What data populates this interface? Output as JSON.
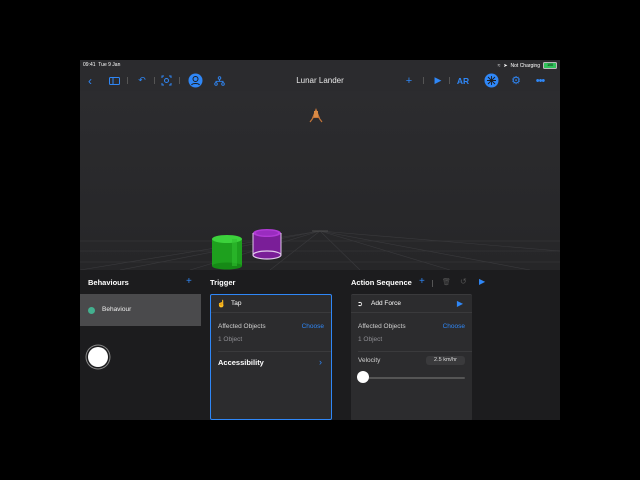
{
  "status": {
    "time": "09:41",
    "date": "Tue 9 Jan",
    "battery_text": "Not Charging",
    "battery_pct": "100"
  },
  "toolbar": {
    "title": "Lunar Lander",
    "icons": [
      "back-chevron-icon",
      "sidebar-icon",
      "undo-icon",
      "frame-icon",
      "avatar-icon",
      "hierarchy-icon",
      "add-icon",
      "play-icon",
      "ar-icon",
      "behaviours-icon",
      "settings-icon",
      "more-icon"
    ],
    "ar_label": "AR",
    "accent_color": "#2f87f7"
  },
  "behaviours": {
    "header": "Behaviours",
    "items": [
      {
        "label": "Behaviour",
        "color": "#43b08f"
      }
    ]
  },
  "trigger": {
    "header": "Trigger",
    "card": {
      "title": "Tap",
      "affected_label": "Affected Objects",
      "choose": "Choose",
      "count": "1 Object",
      "accessibility": "Accessibility"
    }
  },
  "action_sequence": {
    "header": "Action Sequence",
    "card": {
      "title": "Add Force",
      "affected_label": "Affected Objects",
      "choose": "Choose",
      "count": "1 Object",
      "velocity_label": "Velocity",
      "velocity_value": "2.5 km/hr",
      "velocity_fraction": 0.0
    }
  }
}
